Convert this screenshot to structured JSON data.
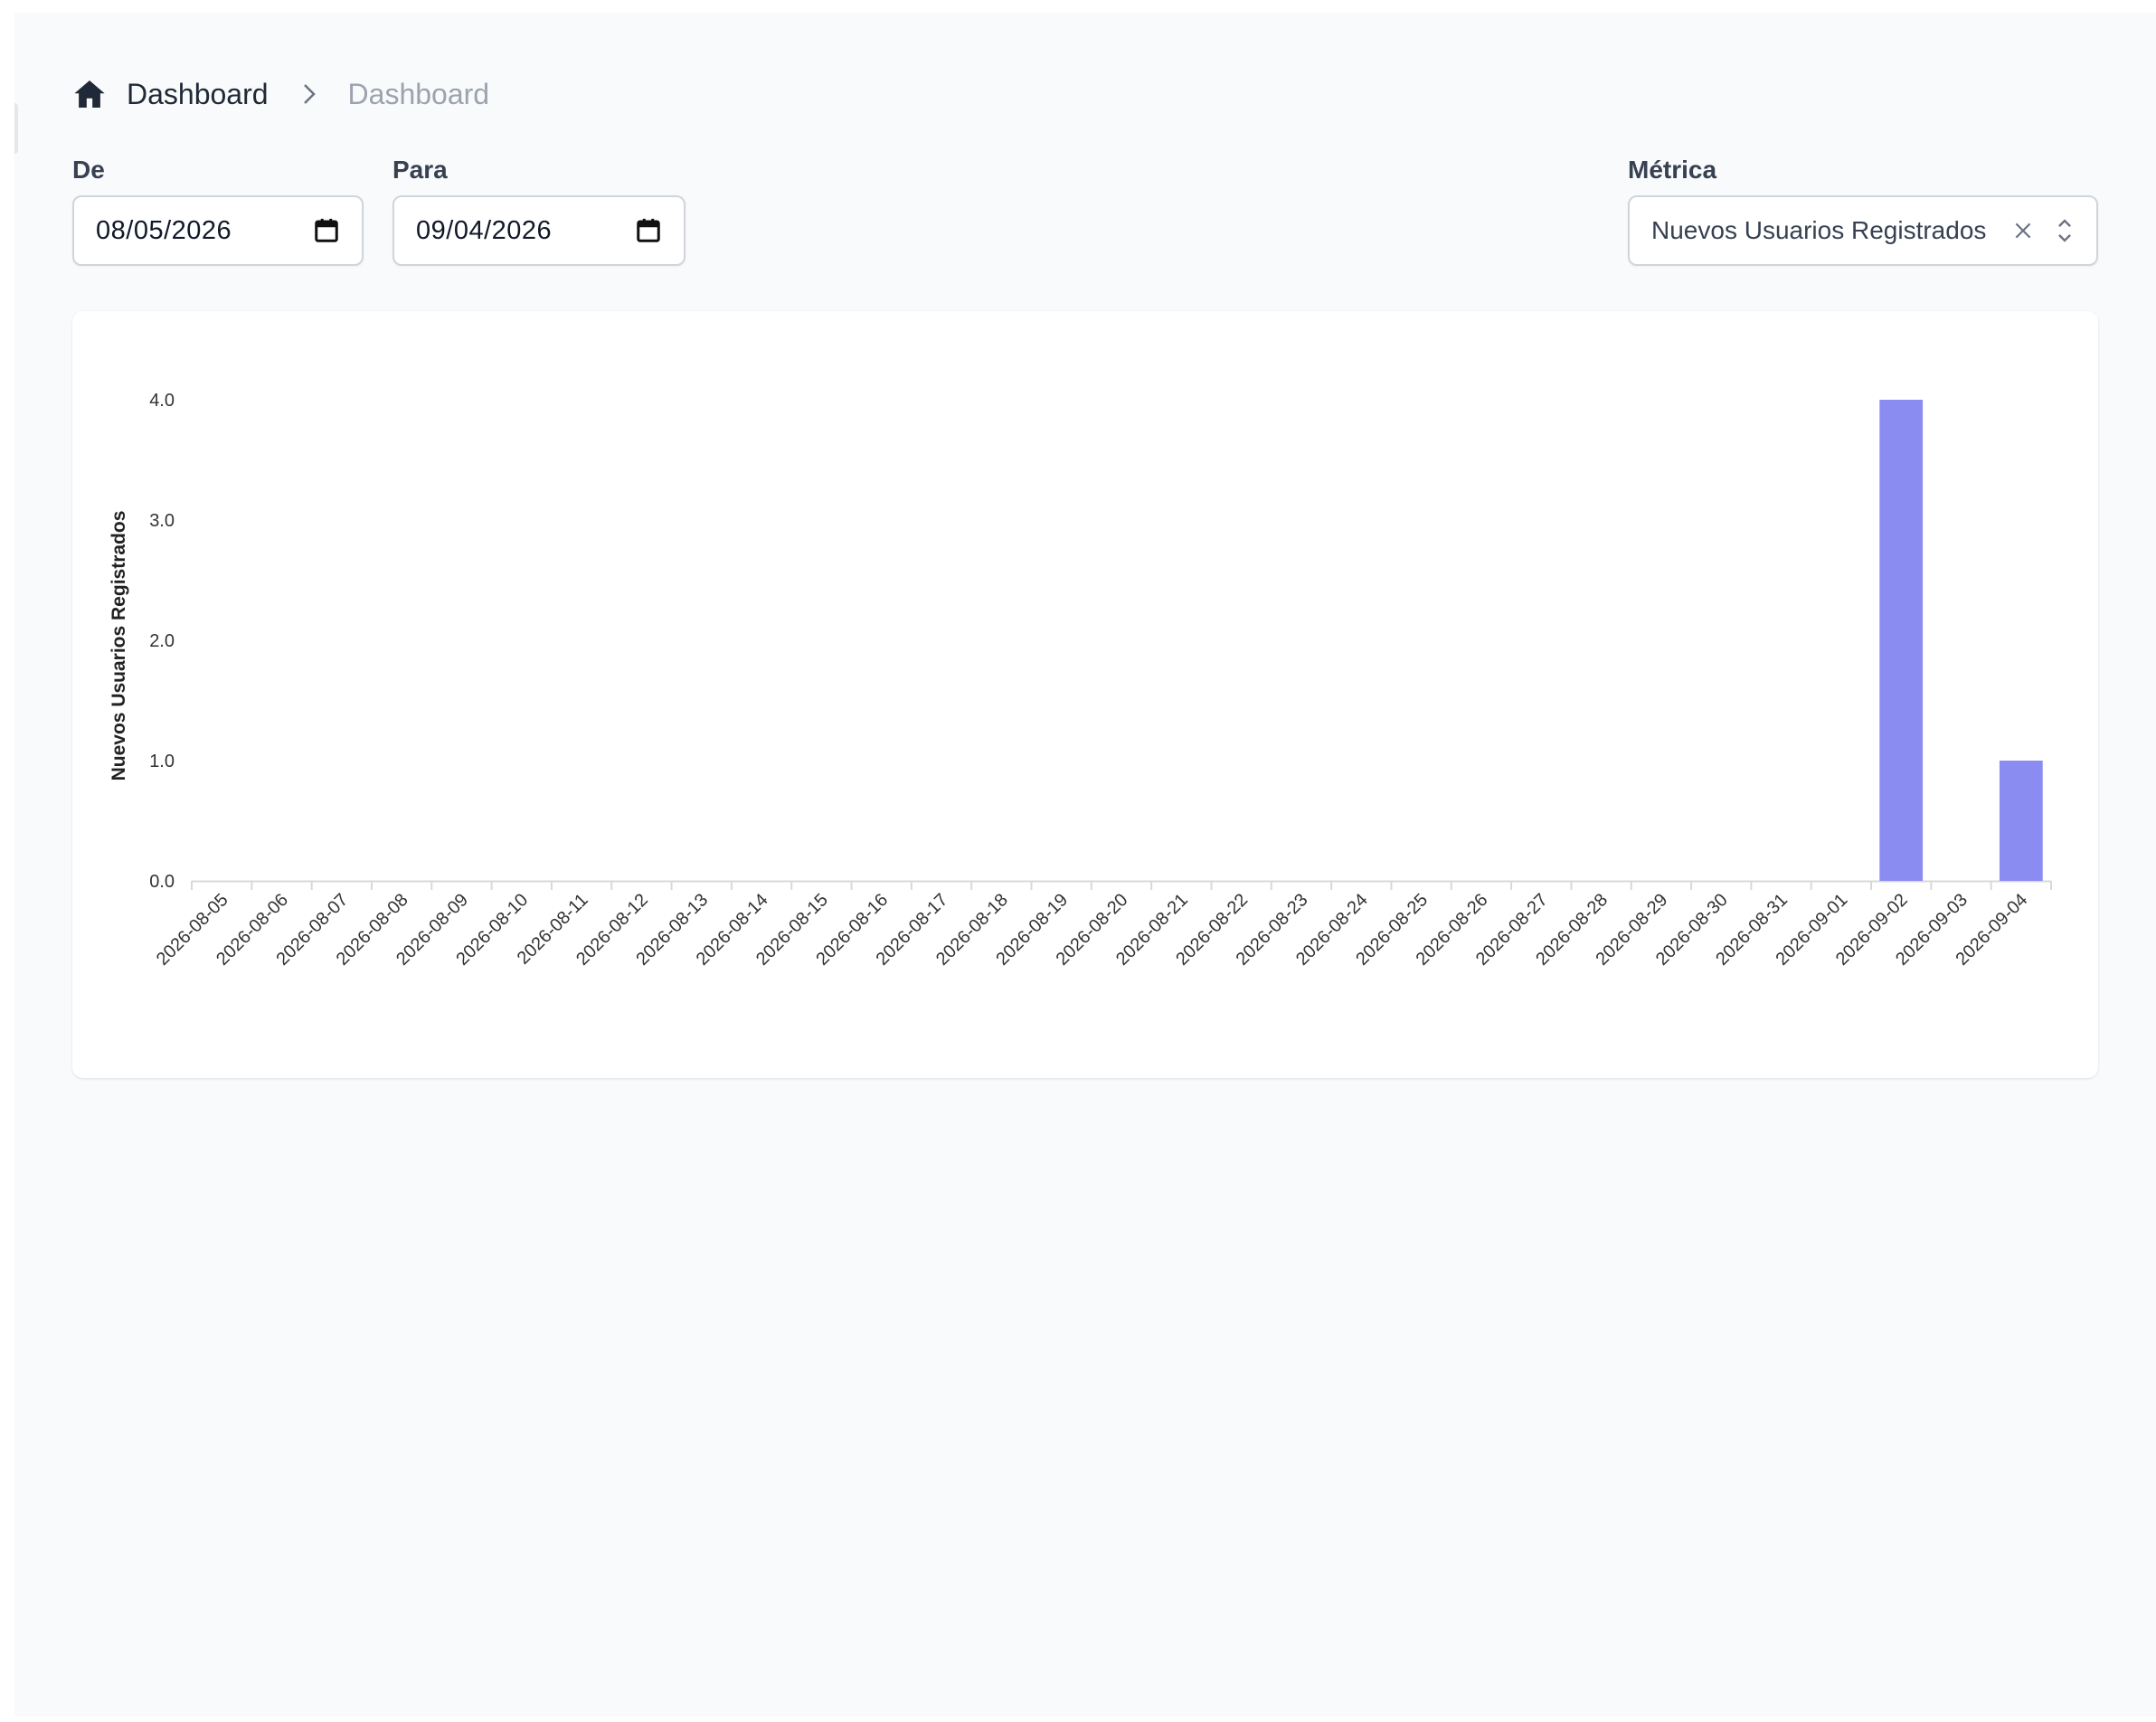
{
  "breadcrumb": {
    "root": "Dashboard",
    "current": "Dashboard"
  },
  "filters": {
    "from_label": "De",
    "from_value": "08/05/2026",
    "to_label": "Para",
    "to_value": "09/04/2026",
    "metric_label": "Métrica",
    "metric_value": "Nuevos Usuarios Registrados"
  },
  "colors": {
    "bar": "#8b8cf2",
    "axis": "#d9d9d9",
    "text": "#333333"
  },
  "chart_data": {
    "type": "bar",
    "ylabel": "Nuevos Usuarios Registrados",
    "ylim": [
      0,
      4
    ],
    "yticks": [
      "0.0",
      "1.0",
      "2.0",
      "3.0",
      "4.0"
    ],
    "categories": [
      "2026-08-05",
      "2026-08-06",
      "2026-08-07",
      "2026-08-08",
      "2026-08-09",
      "2026-08-10",
      "2026-08-11",
      "2026-08-12",
      "2026-08-13",
      "2026-08-14",
      "2026-08-15",
      "2026-08-16",
      "2026-08-17",
      "2026-08-18",
      "2026-08-19",
      "2026-08-20",
      "2026-08-21",
      "2026-08-22",
      "2026-08-23",
      "2026-08-24",
      "2026-08-25",
      "2026-08-26",
      "2026-08-27",
      "2026-08-28",
      "2026-08-29",
      "2026-08-30",
      "2026-08-31",
      "2026-09-01",
      "2026-09-02",
      "2026-09-03",
      "2026-09-04"
    ],
    "values": [
      0,
      0,
      0,
      0,
      0,
      0,
      0,
      0,
      0,
      0,
      0,
      0,
      0,
      0,
      0,
      0,
      0,
      0,
      0,
      0,
      0,
      0,
      0,
      0,
      0,
      0,
      0,
      0,
      4,
      0,
      1
    ],
    "grid": false,
    "legend": "none"
  }
}
